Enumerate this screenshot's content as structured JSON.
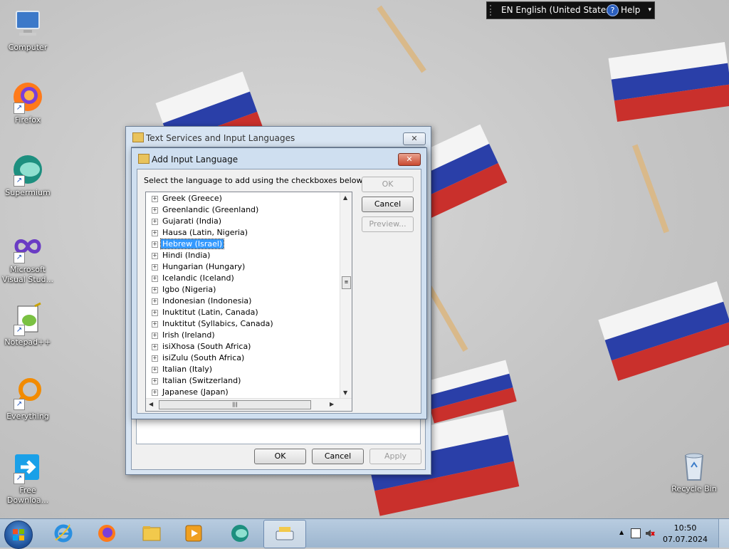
{
  "desktop_icons": [
    {
      "label": "Computer",
      "icon": "computer-icon"
    },
    {
      "label": "Firefox",
      "icon": "firefox-icon"
    },
    {
      "label": "Supermium",
      "icon": "supermium-icon"
    },
    {
      "label": "Microsoft Visual Stud...",
      "icon": "visual-studio-icon"
    },
    {
      "label": "Notepad++",
      "icon": "notepadpp-icon"
    },
    {
      "label": "Everything",
      "icon": "everything-icon"
    },
    {
      "label": "Free Downloa...",
      "icon": "free-download-manager-icon"
    },
    {
      "label": "Recycle Bin",
      "icon": "recycle-bin-icon"
    }
  ],
  "language_bar": {
    "language": "EN English (United States)",
    "help": "Help",
    "help_glyph": "?",
    "menu_glyph": "▾"
  },
  "outer_dialog": {
    "title": "Text Services and Input Languages",
    "close_glyph": "✕",
    "ok": "OK",
    "cancel": "Cancel",
    "apply": "Apply"
  },
  "inner_dialog": {
    "title": "Add Input Language",
    "close_glyph": "✕",
    "instruction": "Select the language to add using the checkboxes below.",
    "ok": "OK",
    "cancel": "Cancel",
    "preview": "Preview...",
    "selected_item": "Hebrew (Israel)",
    "languages": [
      "Greek (Greece)",
      "Greenlandic (Greenland)",
      "Gujarati (India)",
      "Hausa (Latin, Nigeria)",
      "Hebrew (Israel)",
      "Hindi (India)",
      "Hungarian (Hungary)",
      "Icelandic (Iceland)",
      "Igbo (Nigeria)",
      "Indonesian (Indonesia)",
      "Inuktitut (Latin, Canada)",
      "Inuktitut (Syllabics, Canada)",
      "Irish (Ireland)",
      "isiXhosa (South Africa)",
      "isiZulu (South Africa)",
      "Italian (Italy)",
      "Italian (Switzerland)",
      "Japanese (Japan)"
    ],
    "expand_glyph": "+",
    "scroll_up": "▲",
    "scroll_down": "▼",
    "scroll_left": "◀",
    "scroll_right": "▶",
    "thumb_grip": "≡",
    "h_thumb_grip": "|||"
  },
  "taskbar": {
    "apps": [
      {
        "name": "Internet Explorer",
        "icon": "internet-explorer-icon"
      },
      {
        "name": "Firefox",
        "icon": "firefox-icon"
      },
      {
        "name": "File Explorer",
        "icon": "folder-icon"
      },
      {
        "name": "Media Player",
        "icon": "media-player-icon"
      },
      {
        "name": "Supermium",
        "icon": "supermium-icon"
      },
      {
        "name": "Keyboard Settings",
        "icon": "keyboard-icon"
      }
    ],
    "tray_up_glyph": "▲",
    "time": "10:50",
    "date": "07.07.2024"
  },
  "colors": {
    "selection": "#3399ff",
    "flag_white": "#f4f4f4",
    "flag_blue": "#2a3fa8",
    "flag_red": "#c9302c"
  }
}
